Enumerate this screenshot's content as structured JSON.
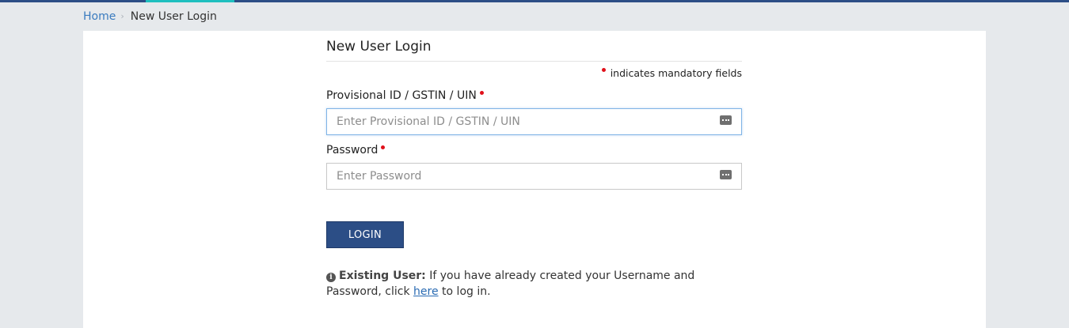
{
  "breadcrumb": {
    "home": "Home",
    "separator": "›",
    "current": "New User Login"
  },
  "form": {
    "title": "New User Login",
    "mandatory_note": "indicates mandatory fields",
    "id_label": "Provisional ID / GSTIN / UIN",
    "id_placeholder": "Enter Provisional ID / GSTIN / UIN",
    "id_value": "",
    "password_label": "Password",
    "password_placeholder": "Enter Password",
    "password_value": "",
    "login_button": "LOGIN"
  },
  "info": {
    "icon": "info-circle-icon",
    "heading": "Existing User:",
    "text_before_link": " If you have already created your Username and Password, click ",
    "link_text": "here",
    "text_after_link": " to log in."
  },
  "colors": {
    "brand": "#2c4e86",
    "accent": "#1fbfbf",
    "mandatory_dot": "#e0101a",
    "link": "#3a7bbf",
    "background": "#e6e9ec"
  }
}
